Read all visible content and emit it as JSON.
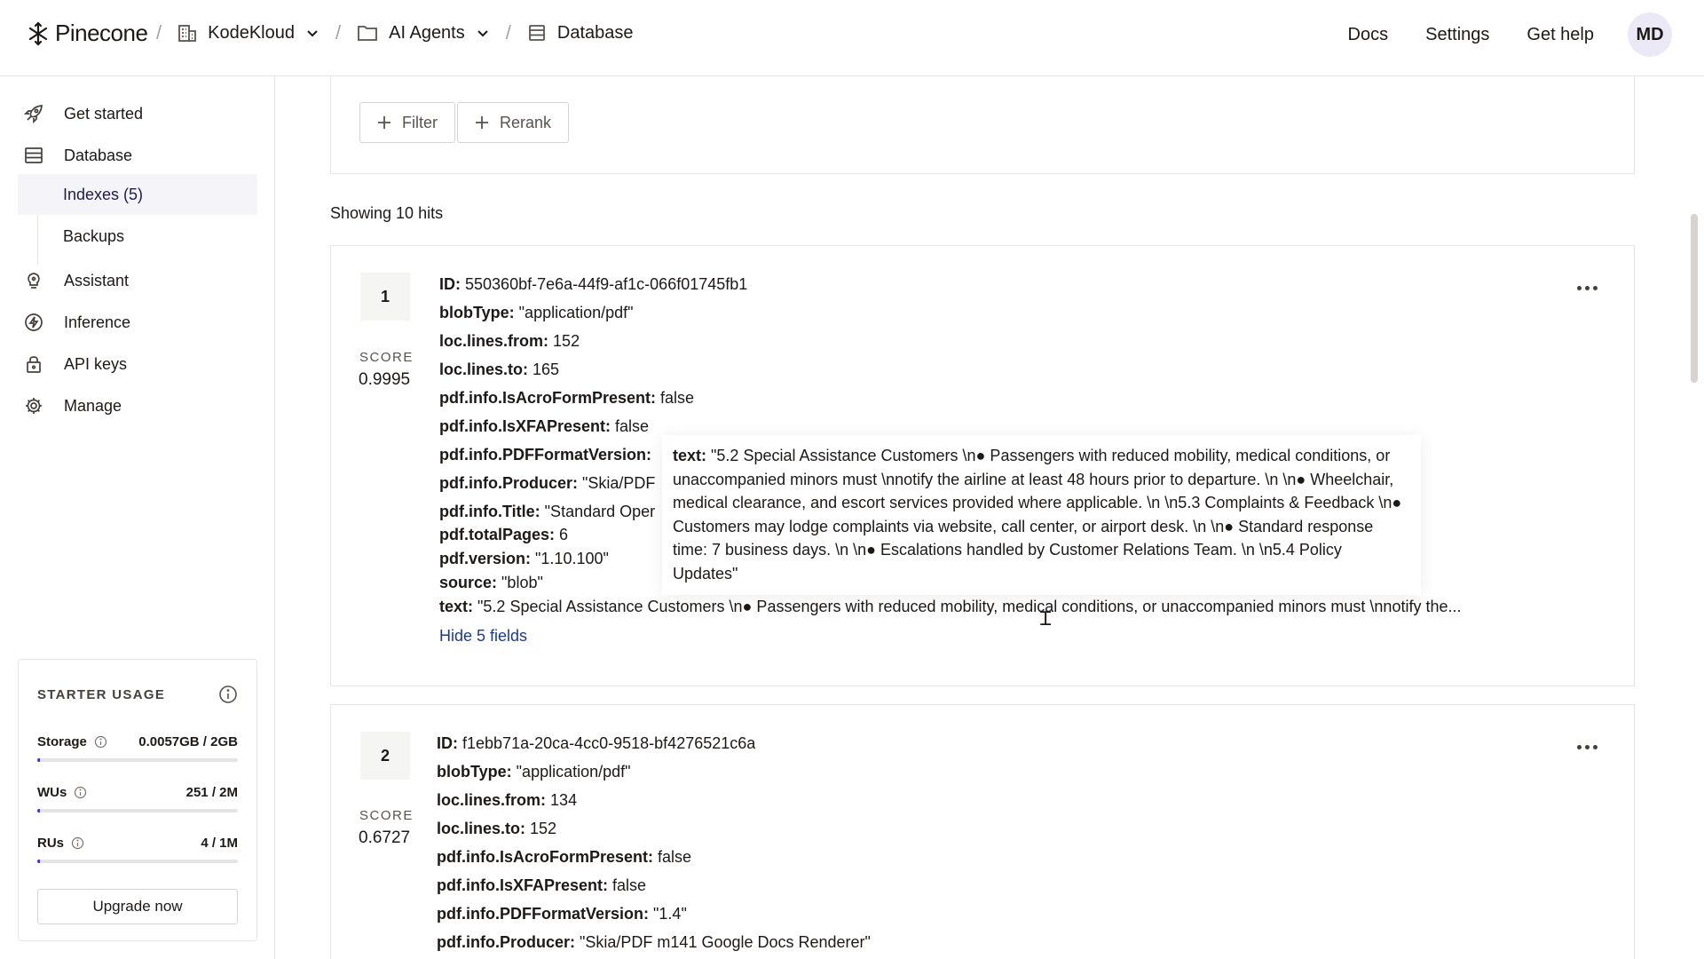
{
  "header": {
    "brand": "Pinecone",
    "breadcrumbs": [
      {
        "label": "KodeKloud",
        "icon": "building-icon",
        "dropdown": true
      },
      {
        "label": "AI Agents",
        "icon": "folder-icon",
        "dropdown": true
      },
      {
        "label": "Database",
        "icon": "database-icon",
        "dropdown": false
      }
    ],
    "links": [
      "Docs",
      "Settings",
      "Get help"
    ],
    "avatar_initials": "MD"
  },
  "sidebar": {
    "items": [
      {
        "label": "Get started",
        "icon": "rocket-icon"
      },
      {
        "label": "Database",
        "icon": "database-icon"
      },
      {
        "label": "Assistant",
        "icon": "lightbulb-icon"
      },
      {
        "label": "Inference",
        "icon": "bolt-icon"
      },
      {
        "label": "API keys",
        "icon": "lock-icon"
      },
      {
        "label": "Manage",
        "icon": "gear-icon"
      }
    ],
    "subitems": [
      {
        "label": "Indexes (5)",
        "active": true
      },
      {
        "label": "Backups",
        "active": false
      }
    ],
    "usage": {
      "title": "STARTER USAGE",
      "rows": [
        {
          "label": "Storage",
          "value": "0.0057GB / 2GB",
          "fraction": 0.003
        },
        {
          "label": "WUs",
          "value": "251 / 2M",
          "fraction": 0.0001
        },
        {
          "label": "RUs",
          "value": "4 / 1M",
          "fraction": 1e-05
        }
      ],
      "upgrade_label": "Upgrade now"
    }
  },
  "main": {
    "filter_label": "Filter",
    "rerank_label": "Rerank",
    "hits_text": "Showing 10 hits",
    "results": [
      {
        "rank": "1",
        "score_label": "SCORE",
        "score": "0.9995",
        "fields": [
          {
            "key": "ID:",
            "value": "550360bf-7e6a-44f9-af1c-066f01745fb1"
          },
          {
            "key": "blobType:",
            "value": "\"application/pdf\""
          },
          {
            "key": "loc.lines.from:",
            "value": "152"
          },
          {
            "key": "loc.lines.to:",
            "value": "165"
          },
          {
            "key": "pdf.info.IsAcroFormPresent:",
            "value": "false"
          },
          {
            "key": "pdf.info.IsXFAPresent:",
            "value": "false"
          },
          {
            "key": "pdf.info.PDFFormatVersion:",
            "value": ""
          },
          {
            "key": "pdf.info.Producer:",
            "value": "\"Skia/PDF"
          },
          {
            "key": "pdf.info.Title:",
            "value": "\"Standard Oper"
          },
          {
            "key": "pdf.totalPages:",
            "value": "6"
          },
          {
            "key": "pdf.version:",
            "value": "\"1.10.100\""
          },
          {
            "key": "source:",
            "value": "\"blob\""
          },
          {
            "key": "text:",
            "value": "\"5.2 Special Assistance Customers \\n● Passengers with reduced mobility, medical conditions, or unaccompanied minors must \\nnotify the..."
          }
        ],
        "toggle_label": "Hide 5 fields",
        "tooltip": {
          "key": "text:",
          "value": "\"5.2 Special Assistance Customers \\n● Passengers with reduced mobility, medical conditions, or unaccompanied minors must \\nnotify the airline at least 48 hours prior to departure. \\n \\n● Wheelchair, medical clearance, and escort services provided where applicable. \\n \\n5.3 Complaints & Feedback \\n● Customers may lodge complaints via website, call center, or airport desk. \\n \\n● Standard response time: 7 business days. \\n \\n● Escalations handled by Customer Relations Team. \\n \\n5.4 Policy Updates\""
        }
      },
      {
        "rank": "2",
        "score_label": "SCORE",
        "score": "0.6727",
        "fields": [
          {
            "key": "ID:",
            "value": "f1ebb71a-20ca-4cc0-9518-bf4276521c6a"
          },
          {
            "key": "blobType:",
            "value": "\"application/pdf\""
          },
          {
            "key": "loc.lines.from:",
            "value": "134"
          },
          {
            "key": "loc.lines.to:",
            "value": "152"
          },
          {
            "key": "pdf.info.IsAcroFormPresent:",
            "value": "false"
          },
          {
            "key": "pdf.info.IsXFAPresent:",
            "value": "false"
          },
          {
            "key": "pdf.info.PDFFormatVersion:",
            "value": "\"1.4\""
          },
          {
            "key": "pdf.info.Producer:",
            "value": "\"Skia/PDF m141 Google Docs Renderer\""
          }
        ]
      }
    ]
  },
  "colors": {
    "accent": "#1e1bb5",
    "link": "#1e3a8a",
    "active_bg": "#f5f4f9",
    "border": "#e7e5e4"
  }
}
